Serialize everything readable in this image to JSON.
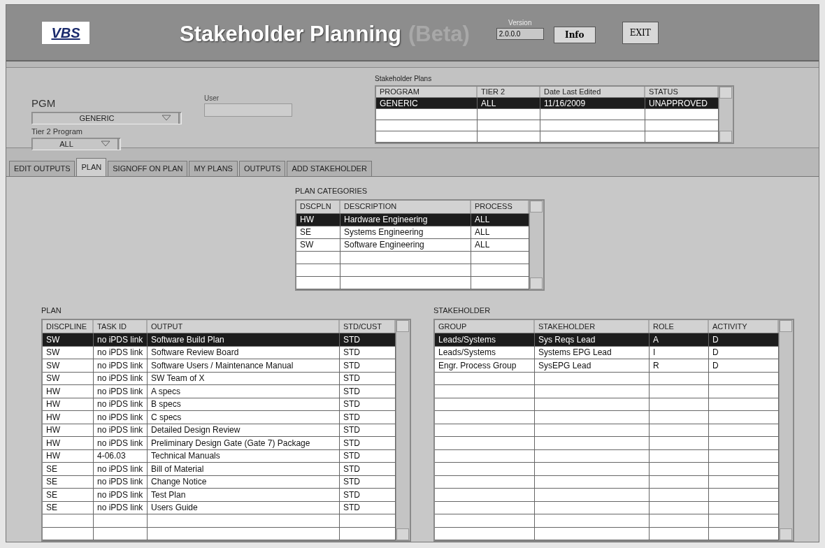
{
  "header": {
    "logo": "VBS",
    "title": "Stakeholder Planning",
    "title_suffix": "(Beta)",
    "version_label": "Version",
    "version": "2.0.0.0",
    "info_button": "Info",
    "exit_button": "EXIT"
  },
  "filters": {
    "pgm_label": "PGM",
    "pgm_value": "GENERIC",
    "user_label": "User",
    "tier2_label": "Tier 2 Program",
    "tier2_value": "ALL"
  },
  "stakeholder_plans": {
    "label": "Stakeholder Plans",
    "columns": [
      "PROGRAM",
      "TIER 2",
      "Date Last Edited",
      "STATUS"
    ],
    "rows": [
      {
        "cells": [
          "GENERIC",
          "ALL",
          "11/16/2009",
          "UNAPPROVED"
        ],
        "selected": true
      }
    ]
  },
  "tabs": [
    {
      "label": "EDIT OUTPUTS",
      "selected": false
    },
    {
      "label": "PLAN",
      "selected": true
    },
    {
      "label": "SIGNOFF ON PLAN",
      "selected": false
    },
    {
      "label": "MY PLANS",
      "selected": false
    },
    {
      "label": "OUTPUTS",
      "selected": false
    },
    {
      "label": "ADD STAKEHOLDER",
      "selected": false
    }
  ],
  "plan_categories": {
    "label": "PLAN CATEGORIES",
    "columns": [
      "DSCPLN",
      "DESCRIPTION",
      "PROCESS"
    ],
    "rows": [
      {
        "cells": [
          "HW",
          "Hardware Engineering",
          "ALL"
        ],
        "selected": true
      },
      {
        "cells": [
          "SE",
          "Systems Engineering",
          "ALL"
        ],
        "selected": false
      },
      {
        "cells": [
          "SW",
          "Software Engineering",
          "ALL"
        ],
        "selected": false
      }
    ]
  },
  "plan": {
    "label": "PLAN",
    "columns": [
      "DISCPLINE",
      "TASK ID",
      "OUTPUT",
      "STD/CUST"
    ],
    "rows": [
      {
        "cells": [
          "SW",
          "no iPDS link",
          "Software Build Plan",
          "STD"
        ],
        "selected": true
      },
      {
        "cells": [
          "SW",
          "no iPDS link",
          "Software Review Board",
          "STD"
        ],
        "selected": false
      },
      {
        "cells": [
          "SW",
          "no iPDS link",
          "Software Users / Maintenance Manual",
          "STD"
        ],
        "selected": false
      },
      {
        "cells": [
          "SW",
          "no iPDS link",
          "SW Team of X",
          "STD"
        ],
        "selected": false
      },
      {
        "cells": [
          "HW",
          "no iPDS link",
          "A specs",
          "STD"
        ],
        "selected": false
      },
      {
        "cells": [
          "HW",
          "no iPDS link",
          "B specs",
          "STD"
        ],
        "selected": false
      },
      {
        "cells": [
          "HW",
          "no iPDS link",
          "C specs",
          "STD"
        ],
        "selected": false
      },
      {
        "cells": [
          "HW",
          "no iPDS link",
          "Detailed Design Review",
          "STD"
        ],
        "selected": false
      },
      {
        "cells": [
          "HW",
          "no iPDS link",
          "Preliminary Design Gate (Gate 7) Package",
          "STD"
        ],
        "selected": false
      },
      {
        "cells": [
          "HW",
          "4-06.03",
          "Technical Manuals",
          "STD"
        ],
        "selected": false
      },
      {
        "cells": [
          "SE",
          "no iPDS link",
          "Bill of Material",
          "STD"
        ],
        "selected": false
      },
      {
        "cells": [
          "SE",
          "no iPDS link",
          "Change Notice",
          "STD"
        ],
        "selected": false
      },
      {
        "cells": [
          "SE",
          "no iPDS link",
          "Test Plan",
          "STD"
        ],
        "selected": false
      },
      {
        "cells": [
          "SE",
          "no iPDS link",
          "Users Guide",
          "STD"
        ],
        "selected": false
      }
    ]
  },
  "stakeholder": {
    "label": "STAKEHOLDER",
    "columns": [
      "GROUP",
      "STAKEHOLDER",
      "ROLE",
      "ACTIVITY"
    ],
    "rows": [
      {
        "cells": [
          "Leads/Systems",
          "Sys Reqs Lead",
          "A",
          "D"
        ],
        "selected": true
      },
      {
        "cells": [
          "Leads/Systems",
          "Systems EPG Lead",
          "I",
          "D"
        ],
        "selected": false
      },
      {
        "cells": [
          "Engr. Process Group",
          "SysEPG Lead",
          "R",
          "D"
        ],
        "selected": false
      }
    ]
  }
}
